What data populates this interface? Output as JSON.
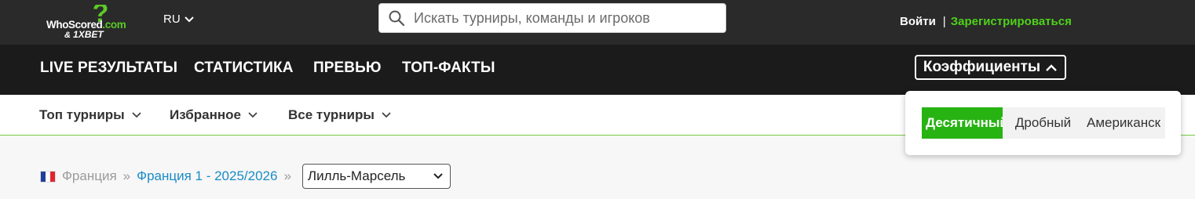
{
  "topbar": {
    "logo": {
      "text_main": "WhoScored",
      "text_dom": ".com",
      "text_amp": "&",
      "text_partner": "1XBET"
    },
    "language": {
      "label": "RU"
    },
    "search": {
      "placeholder": "Искать турниры, команды и игроков",
      "value": ""
    },
    "auth": {
      "login_label": "Войти",
      "separator": "|",
      "register_label": "Зарегистрироваться"
    }
  },
  "main_nav": {
    "items": [
      {
        "label": "LIVE РЕЗУЛЬТАТЫ"
      },
      {
        "label": "СТАТИСТИКА"
      },
      {
        "label": "ПРЕВЬЮ"
      },
      {
        "label": "ТОП-ФАКТЫ"
      }
    ],
    "odds_button": {
      "label": "Коэффициенты"
    }
  },
  "sub_nav": {
    "items": [
      {
        "label": "Топ турниры"
      },
      {
        "label": "Избранное"
      },
      {
        "label": "Все турниры"
      }
    ]
  },
  "breadcrumb": {
    "country": "Франция",
    "separator": "»",
    "league": "Франция 1 - 2025/2026",
    "match_select": {
      "selected": "Лилль-Марсель"
    }
  },
  "odds_dropdown": {
    "options": [
      {
        "label": "Десятичный",
        "active": true
      },
      {
        "label": "Дробный",
        "active": false
      },
      {
        "label": "Американск",
        "active": false
      }
    ]
  },
  "colors": {
    "topbar_bg": "#2a2a2a",
    "nav_bg": "#1b1b1b",
    "accent_green": "#27b312",
    "register_green": "#4fd11a",
    "link_blue": "#1a8bc6",
    "subnav_border": "#7ac943"
  }
}
